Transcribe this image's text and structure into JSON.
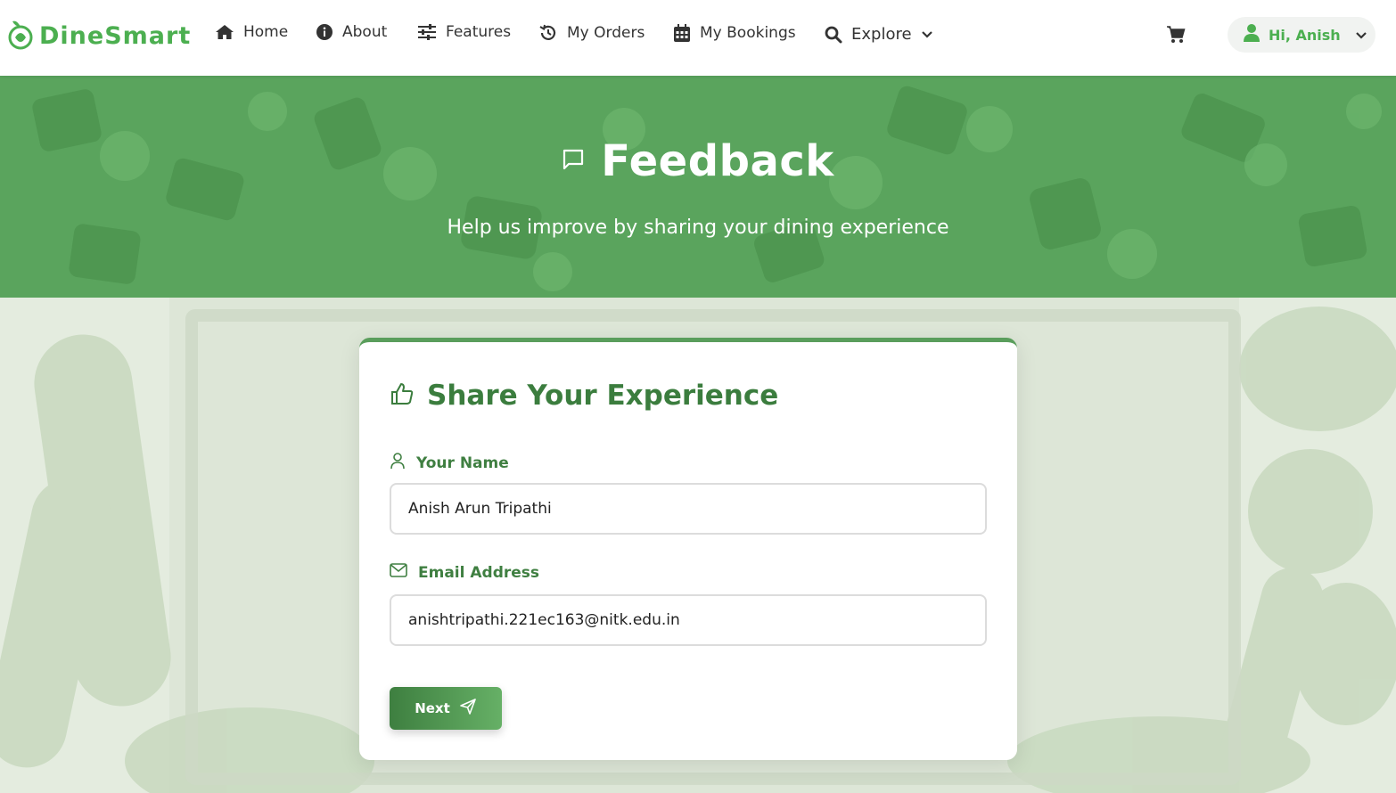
{
  "brand": {
    "name": "DineSmart"
  },
  "nav": {
    "home": "Home",
    "about": "About",
    "features": "Features",
    "orders": "My Orders",
    "bookings": "My Bookings",
    "explore": "Explore"
  },
  "user": {
    "greeting": "Hi, Anish"
  },
  "hero": {
    "title": "Feedback",
    "subtitle": "Help us improve by sharing your dining experience"
  },
  "form": {
    "title": "Share Your Experience",
    "name_label": "Your Name",
    "name_value": "Anish Arun Tripathi",
    "email_label": "Email Address",
    "email_value": "anishtripathi.221ec163@nitk.edu.in",
    "next_label": "Next"
  },
  "colors": {
    "brand": "#4caf50",
    "hero_bg": "#5aa45d",
    "accent_dark": "#3b7d3e"
  },
  "icons": {
    "brand": "leaf-logo-icon",
    "home": "home-icon",
    "about": "info-icon",
    "features": "sliders-icon",
    "orders": "history-icon",
    "bookings": "calendar-icon",
    "explore": "search-icon",
    "cart": "cart-icon",
    "user": "user-icon",
    "hero": "chat-bubble-icon",
    "form_title": "thumbs-up-icon",
    "name": "person-icon",
    "email": "mail-icon",
    "next": "send-icon"
  }
}
